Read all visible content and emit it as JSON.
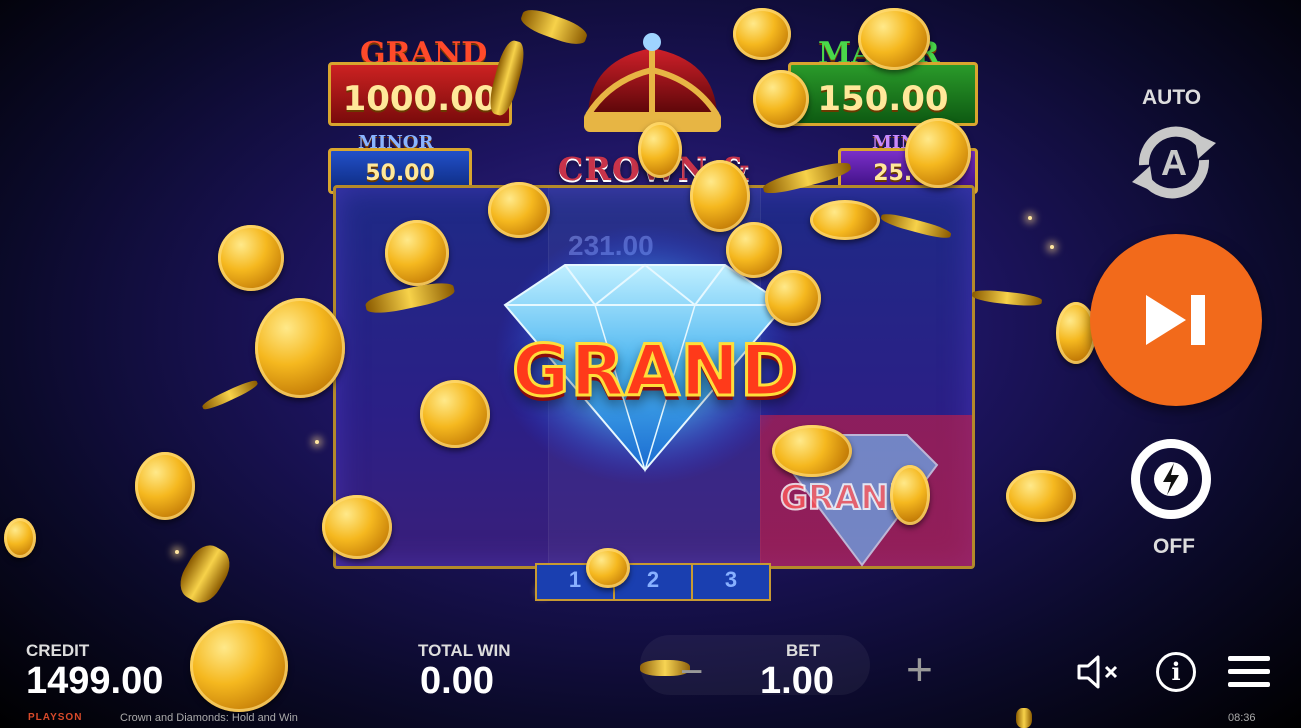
{
  "game": {
    "title": "CROWN & DIAMONDS",
    "footer_brand": "PLAYSON",
    "footer_name": "Crown and Diamonds: Hold and Win",
    "clock": "08:36"
  },
  "jackpots": {
    "grand": {
      "label": "GRAND",
      "value": "1000.00"
    },
    "major": {
      "label": "MAJOR",
      "value": "150.00"
    },
    "minor": {
      "label": "MINOR",
      "value": "50.00"
    },
    "mini": {
      "label": "MINI",
      "value": "25.00"
    }
  },
  "win_banner": "GRAND",
  "small_banner": "GRAND",
  "ghost_value": "231.00",
  "pager": [
    "1",
    "2",
    "3"
  ],
  "controls": {
    "auto_label": "AUTO",
    "turbo_label": "OFF",
    "play_icon": "skip-forward-icon"
  },
  "hud": {
    "credit_label": "CREDIT",
    "credit_value": "1499.00",
    "total_win_label": "TOTAL WIN",
    "total_win_value": "0.00",
    "bet_label": "BET",
    "bet_value": "1.00",
    "minus": "−",
    "plus": "+"
  },
  "colors": {
    "accent_orange": "#f26a1b",
    "gold": "#f5b81f",
    "frame_gold": "#b48a2a"
  }
}
